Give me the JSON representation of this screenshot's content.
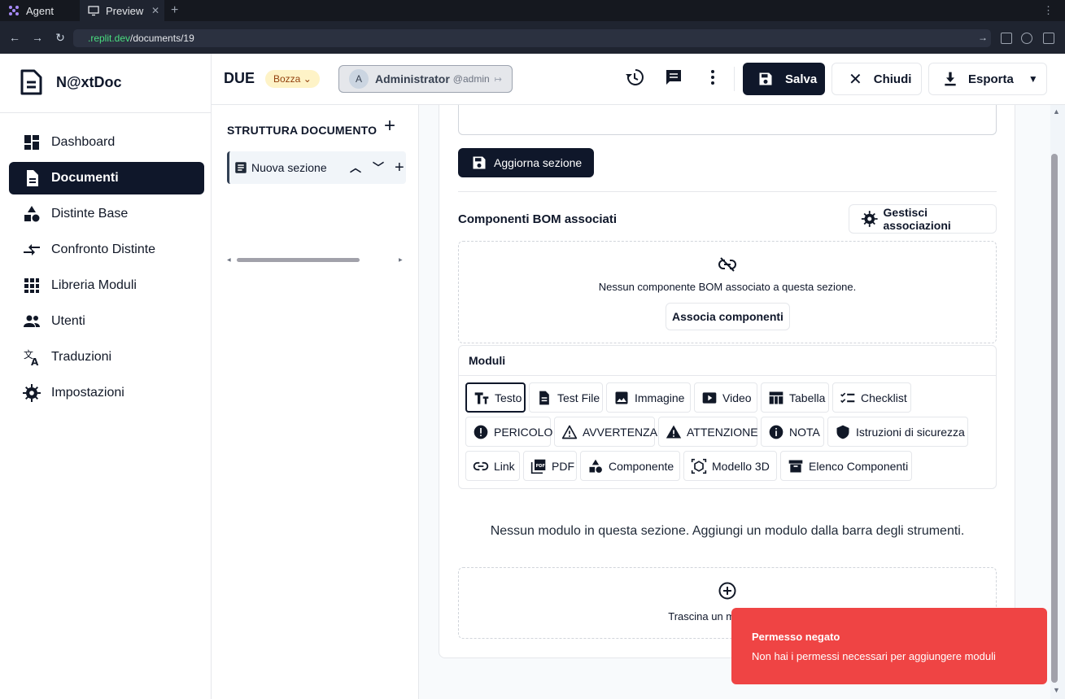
{
  "browser": {
    "tabs": [
      {
        "label": "Agent"
      },
      {
        "label": "Preview"
      }
    ],
    "url_host": ".replit.dev",
    "url_path": "/documents/19"
  },
  "app": {
    "name": "N@xtDoc"
  },
  "sidebar": {
    "items": [
      {
        "label": "Dashboard",
        "icon": "dashboard-icon"
      },
      {
        "label": "Documenti",
        "icon": "document-icon"
      },
      {
        "label": "Distinte Base",
        "icon": "shapes-icon"
      },
      {
        "label": "Confronto Distinte",
        "icon": "compare-arrows-icon"
      },
      {
        "label": "Libreria Moduli",
        "icon": "grid-icon"
      },
      {
        "label": "Utenti",
        "icon": "users-icon"
      },
      {
        "label": "Traduzioni",
        "icon": "translate-icon"
      },
      {
        "label": "Impostazioni",
        "icon": "gear-icon"
      }
    ],
    "active_index": 1
  },
  "header": {
    "doc_title": "DUE",
    "status_badge": "Bozza",
    "user_initial": "A",
    "user_name": "Administrator",
    "user_handle": "@admin",
    "save_label": "Salva",
    "close_label": "Chiudi",
    "export_label": "Esporta"
  },
  "structure": {
    "title": "STRUTTURA DOCUMENTO",
    "sections": [
      {
        "label": "Nuova sezione"
      }
    ]
  },
  "editor": {
    "update_section_label": "Aggiorna sezione",
    "bom_title": "Componenti BOM associati",
    "manage_assoc_label": "Gestisci associazioni",
    "bom_empty_msg": "Nessun componente BOM associato a questa sezione.",
    "assoc_components_label": "Associa componenti",
    "modules_title": "Moduli",
    "modules": [
      {
        "label": "Testo",
        "icon": "text-icon"
      },
      {
        "label": "Test File",
        "icon": "file-icon"
      },
      {
        "label": "Immagine",
        "icon": "image-icon"
      },
      {
        "label": "Video",
        "icon": "video-icon"
      },
      {
        "label": "Tabella",
        "icon": "table-icon"
      },
      {
        "label": "Checklist",
        "icon": "checklist-icon"
      },
      {
        "label": "PERICOLO",
        "icon": "danger-icon"
      },
      {
        "label": "AVVERTENZA",
        "icon": "warning-outline-icon"
      },
      {
        "label": "ATTENZIONE",
        "icon": "warning-filled-icon"
      },
      {
        "label": "NOTA",
        "icon": "info-icon"
      },
      {
        "label": "Istruzioni di sicurezza",
        "icon": "shield-icon"
      },
      {
        "label": "Link",
        "icon": "link-icon"
      },
      {
        "label": "PDF",
        "icon": "pdf-icon"
      },
      {
        "label": "Componente",
        "icon": "shapes-icon"
      },
      {
        "label": "Modello 3D",
        "icon": "cube-icon"
      },
      {
        "label": "Elenco Componenti",
        "icon": "archive-icon"
      }
    ],
    "no_modules_msg": "Nessun modulo in questa sezione. Aggiungi un modulo dalla barra degli strumenti.",
    "drop_msg": "Trascina un modulo qui o"
  },
  "toast": {
    "title": "Permesso negato",
    "message": "Non hai i permessi necessari per aggiungere moduli",
    "color": "#ef4444"
  }
}
